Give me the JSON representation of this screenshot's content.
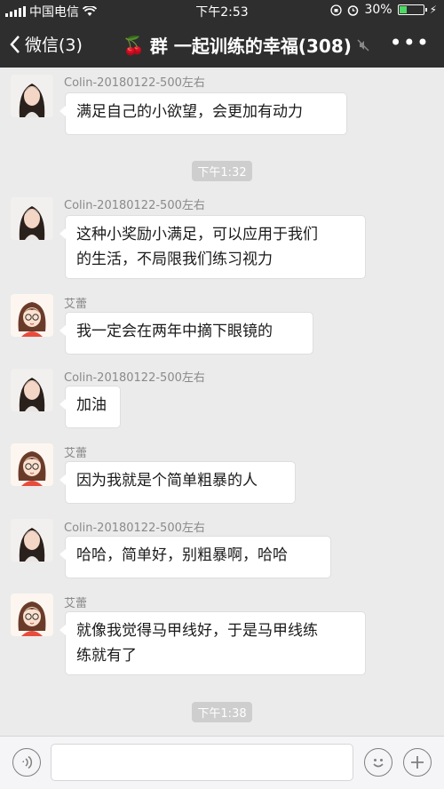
{
  "status_bar": {
    "carrier": "中国电信",
    "time": "下午2:53",
    "battery_percent": "30%",
    "battery_level": 0.3
  },
  "nav": {
    "back_label": "微信(3)",
    "title_emoji": "🍒",
    "title": "群 一起训练的幸福(308)",
    "more_label": "•••"
  },
  "messages": [
    {
      "sender": "Colin-20180122-500左右",
      "text": "满足自己的小欲望，会更加有动力",
      "avatar": "girl-photo"
    },
    {
      "timestamp": "下午1:32"
    },
    {
      "sender": "Colin-20180122-500左右",
      "lines": [
        "这种小奖励小满足，可以应用于我们",
        "的生活，不局限我们练习视力"
      ],
      "avatar": "girl-photo"
    },
    {
      "sender": "艾蕾",
      "text": "我一定会在两年中摘下眼镜的",
      "avatar": "cartoon-girl"
    },
    {
      "sender": "Colin-20180122-500左右",
      "text": "加油",
      "avatar": "girl-photo"
    },
    {
      "sender": "艾蕾",
      "text": "因为我就是个简单粗暴的人",
      "avatar": "cartoon-girl"
    },
    {
      "sender": "Colin-20180122-500左右",
      "text": "哈哈，简单好，别粗暴啊，哈哈",
      "avatar": "girl-photo"
    },
    {
      "sender": "艾蕾",
      "lines": [
        "就像我觉得马甲线好，于是马甲线练",
        "练就有了"
      ],
      "avatar": "cartoon-girl"
    },
    {
      "timestamp": "下午1:38"
    }
  ],
  "input_bar": {
    "voice_icon": "voice-icon",
    "emoji_icon": "emoji-icon",
    "plus_icon": "plus-icon"
  }
}
